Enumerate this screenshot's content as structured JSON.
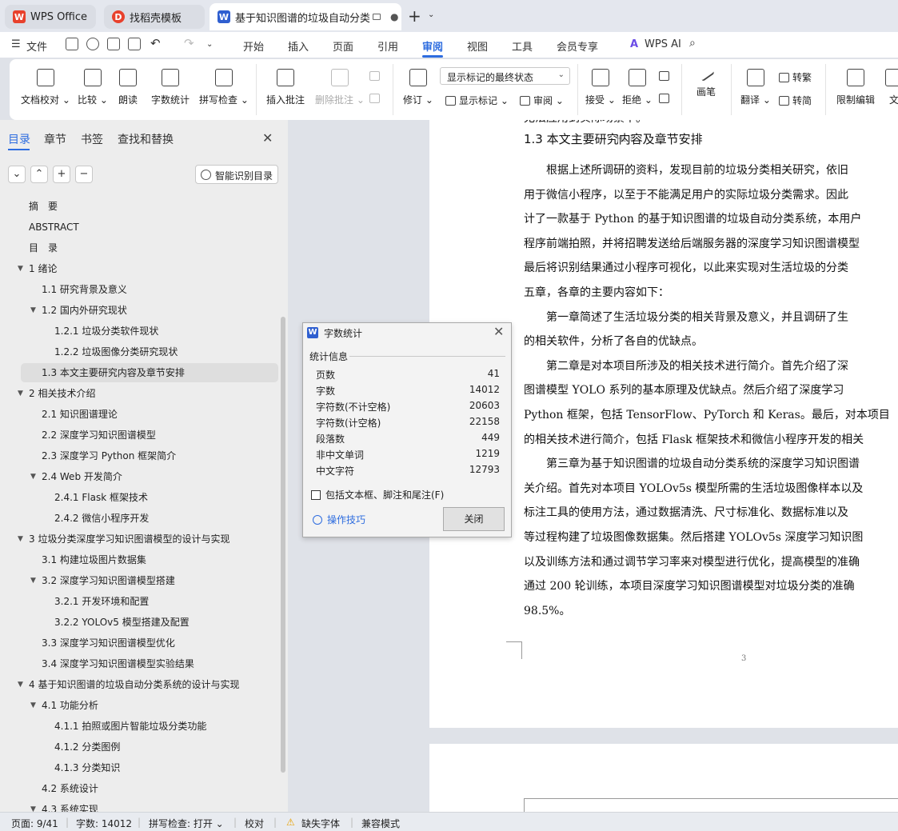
{
  "tabs": [
    {
      "label": "WPS Office"
    },
    {
      "label": "找稻壳模板"
    },
    {
      "label": "基于知识图谱的垃圾自动分类系"
    }
  ],
  "menu": {
    "file": "文件",
    "items": [
      "开始",
      "插入",
      "页面",
      "引用",
      "审阅",
      "视图",
      "工具",
      "会员专享"
    ],
    "active": "审阅",
    "wps_ai": "WPS AI"
  },
  "ribbon": {
    "doc_check": "文档校对",
    "compare": "比较",
    "read_aloud": "朗读",
    "word_count": "字数统计",
    "spell_check": "拼写检查",
    "insert_comment": "插入批注",
    "delete_comment": "删除批注",
    "revise": "修订",
    "markup_mode": "显示标记的最终状态",
    "show_markup": "显示标记",
    "review": "审阅",
    "accept": "接受",
    "reject": "拒绝",
    "pen": "画笔",
    "translate": "翻译",
    "to_traditional": "转繁",
    "to_simplified": "转简",
    "restrict_edit": "限制编辑",
    "doc_more": "文"
  },
  "panel": {
    "tabs": [
      "目录",
      "章节",
      "书签",
      "查找和替换"
    ],
    "smart_toc": "智能识别目录",
    "toc": [
      {
        "text": "摘　要",
        "level": 0
      },
      {
        "text": "ABSTRACT",
        "level": 0
      },
      {
        "text": "目　录",
        "level": 0
      },
      {
        "text": "1  绪论",
        "level": 0,
        "expanded": true
      },
      {
        "text": "1.1  研究背景及意义",
        "level": 1
      },
      {
        "text": "1.2  国内外研究现状",
        "level": 1,
        "expanded": true
      },
      {
        "text": "1.2.1  垃圾分类软件现状",
        "level": 2
      },
      {
        "text": "1.2.2  垃圾图像分类研究现状",
        "level": 2
      },
      {
        "text": "1.3  本文主要研究内容及章节安排",
        "level": 1,
        "selected": true
      },
      {
        "text": "2  相关技术介绍",
        "level": 0,
        "expanded": true
      },
      {
        "text": "2.1  知识图谱理论",
        "level": 1
      },
      {
        "text": "2.2  深度学习知识图谱模型",
        "level": 1
      },
      {
        "text": "2.3  深度学习 Python 框架简介",
        "level": 1
      },
      {
        "text": "2.4 Web 开发简介",
        "level": 1,
        "expanded": true
      },
      {
        "text": "2.4.1 Flask 框架技术",
        "level": 2
      },
      {
        "text": "2.4.2  微信小程序开发",
        "level": 2
      },
      {
        "text": "3  垃圾分类深度学习知识图谱模型的设计与实现",
        "level": 0,
        "expanded": true
      },
      {
        "text": "3.1  构建垃圾图片数据集",
        "level": 1
      },
      {
        "text": "3.2  深度学习知识图谱模型搭建",
        "level": 1,
        "expanded": true
      },
      {
        "text": "3.2.1  开发环境和配置",
        "level": 2
      },
      {
        "text": "3.2.2 YOLOv5 模型搭建及配置",
        "level": 2
      },
      {
        "text": "3.3  深度学习知识图谱模型优化",
        "level": 1
      },
      {
        "text": "3.4  深度学习知识图谱模型实验结果",
        "level": 1
      },
      {
        "text": "4  基于知识图谱的垃圾自动分类系统的设计与实现",
        "level": 0,
        "expanded": true
      },
      {
        "text": "4.1  功能分析",
        "level": 1,
        "expanded": true
      },
      {
        "text": "4.1.1  拍照或图片智能垃圾分类功能",
        "level": 2
      },
      {
        "text": "4.1.2  分类图例",
        "level": 2
      },
      {
        "text": "4.1.3  分类知识",
        "level": 2
      },
      {
        "text": "4.2  系统设计",
        "level": 1
      },
      {
        "text": "4.3  系统实现",
        "level": 1,
        "expanded": true
      }
    ]
  },
  "document": {
    "top_fragment": "无法应用到实际场景中。",
    "h2_mark": "H₂",
    "heading": "1.3  本文主要研究内容及章节安排",
    "lines": [
      "　　根据上述所调研的资料，发现目前的垃圾分类相关研究，依旧",
      "用于微信小程序，以至于不能满足用户的实际垃圾分类需求。因此",
      "计了一款基于 Python 的基于知识图谱的垃圾自动分类系统，本用户",
      "程序前端拍照，并将招聘发送给后端服务器的深度学习知识图谱模型",
      "最后将识别结果通过小程序可视化，以此来实现对生活垃圾的分类",
      "五章，各章的主要内容如下：",
      "　　第一章简述了生活垃圾分类的相关背景及意义，并且调研了生",
      "的相关软件，分析了各自的优缺点。",
      "　　第二章是对本项目所涉及的相关技术进行简介。首先介绍了深",
      "图谱模型 YOLO 系列的基本原理及优缺点。然后介绍了深度学习",
      "Python 框架，包括 TensorFlow、PyTorch 和 Keras。最后，对本项目",
      "的相关技术进行简介，包括 Flask 框架技术和微信小程序开发的相关",
      "　　第三章为基于知识图谱的垃圾自动分类系统的深度学习知识图谱",
      "关介绍。首先对本项目 YOLOv5s 模型所需的生活垃圾图像样本以及",
      "标注工具的使用方法，通过数据清洗、尺寸标准化、数据标准以及",
      "等过程构建了垃圾图像数据集。然后搭建 YOLOv5s 深度学习知识图",
      "以及训练方法和通过调节学习率来对模型进行优化，提高模型的准确",
      "通过 200 轮训练，本项目深度学习知识图谱模型对垃圾分类的准确",
      "98.5%。"
    ],
    "page_number": "3"
  },
  "dialog": {
    "title": "字数统计",
    "section": "统计信息",
    "stats": [
      {
        "label": "页数",
        "value": "41"
      },
      {
        "label": "字数",
        "value": "14012"
      },
      {
        "label": "字符数(不计空格)",
        "value": "20603"
      },
      {
        "label": "字符数(计空格)",
        "value": "22158"
      },
      {
        "label": "段落数",
        "value": "449"
      },
      {
        "label": "非中文单词",
        "value": "1219"
      },
      {
        "label": "中文字符",
        "value": "12793"
      }
    ],
    "checkbox": "包括文本框、脚注和尾注(F)",
    "tips": "操作技巧",
    "close": "关闭"
  },
  "status": {
    "page": "页面: 9/41",
    "words": "字数: 14012",
    "spell": "拼写检查: 打开",
    "proof": "校对",
    "missing_font": "缺失字体",
    "compat": "兼容模式"
  },
  "colors": {
    "accent": "#2d6cdf",
    "wps_red": "#e8412c"
  }
}
